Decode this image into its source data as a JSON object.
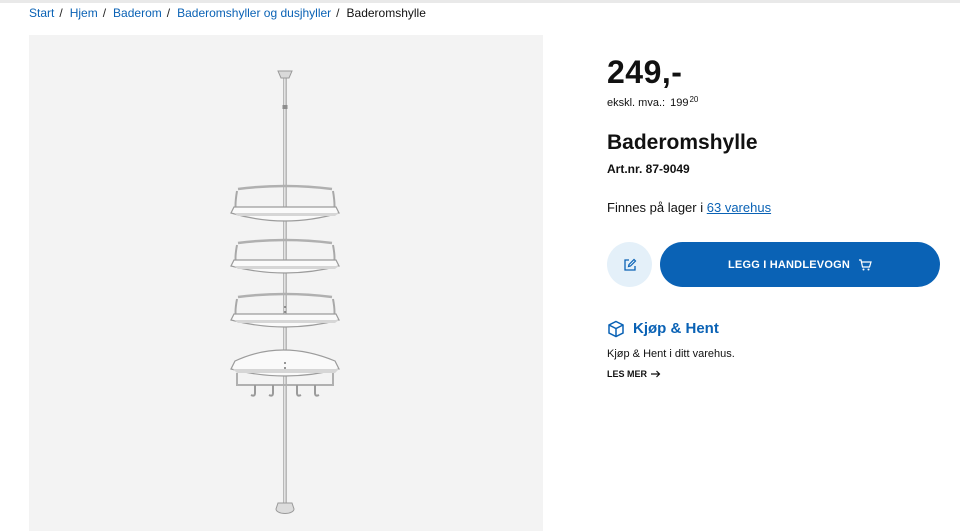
{
  "breadcrumb": {
    "items": [
      "Start",
      "Hjem",
      "Baderom",
      "Baderomshyller og dusjhyller"
    ],
    "separator": "/",
    "current": "Baderomshylle"
  },
  "product": {
    "price": "249,-",
    "ex_vat_label": "ekskl. mva.:",
    "ex_vat_whole": "199",
    "ex_vat_cents": "20",
    "title": "Baderomshylle",
    "article_number": "Art.nr. 87-9049",
    "stock_prefix": "Finnes på lager i",
    "stock_link": "63 varehus"
  },
  "actions": {
    "note_icon": "edit-note-icon",
    "add_to_cart_label": "LEGG I HANDLEVOGN",
    "cart_icon": "cart-icon"
  },
  "click_collect": {
    "icon": "package-icon",
    "title": "Kjøp & Hent",
    "text": "Kjøp & Hent i ditt varehus.",
    "more_label": "LES MER"
  },
  "colors": {
    "brand_blue": "#0a62b5",
    "light_blue": "#e4f0f9",
    "gallery_bg": "#f3f3f3"
  }
}
